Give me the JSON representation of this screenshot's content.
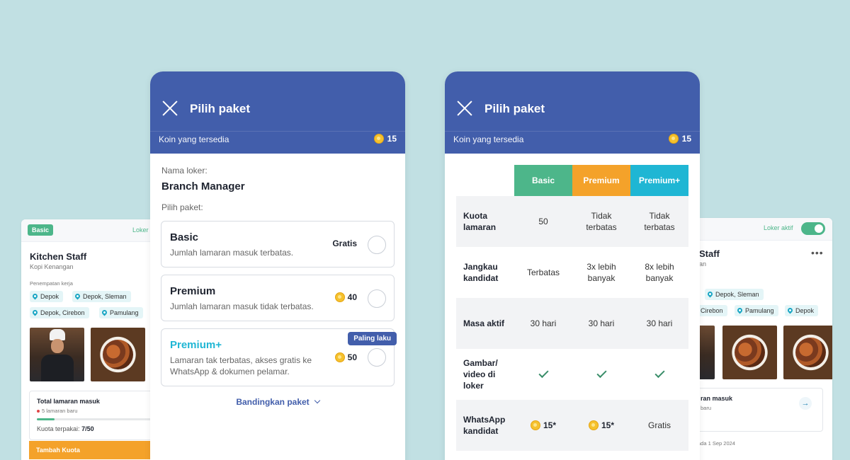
{
  "left_card": {
    "badge": "Basic",
    "status": "Loker",
    "title": "Kitchen Staff",
    "company": "Kopi Kenangan",
    "locations_label": "Penempatan kerja",
    "locations": [
      "Depok",
      "Depok, Sleman",
      "Depok, Cirebon",
      "Pamulang"
    ],
    "stats_title": "Total lamaran masuk",
    "stats_new": "5 lamaran baru",
    "quota_label": "Kuota terpakai:",
    "quota_value": "7/50",
    "quota_progress": 0.14,
    "add_quota_button": "Tambah Kuota"
  },
  "right_card": {
    "status": "Loker aktif",
    "title": "Staff",
    "company_fragment": "an",
    "locations": [
      "Depok, Sleman",
      "Cirebon",
      "Pamulang",
      "Depok"
    ],
    "stats_title": "ran masuk",
    "stats_sub": "baru",
    "date_text": "ada 1 Sep 2024"
  },
  "modal_a": {
    "title": "Pilih paket",
    "coin_label": "Koin yang tersedia",
    "coin_count": "15",
    "job_label": "Nama loker:",
    "job_name": "Branch Manager",
    "package_label": "Pilih paket:",
    "packages": [
      {
        "name": "Basic",
        "desc": "Jumlah lamaran masuk terbatas.",
        "price": "Gratis"
      },
      {
        "name": "Premium",
        "desc": "Jumlah lamaran masuk tidak terbatas.",
        "price": "40"
      },
      {
        "name": "Premium+",
        "desc_line1": "Lamaran tak terbatas, akses gratis ke",
        "desc_line2": "WhatsApp & dokumen pelamar.",
        "price": "50",
        "badge": "Paling laku"
      }
    ],
    "compare_link": "Bandingkan paket"
  },
  "modal_b": {
    "title": "Pilih paket",
    "coin_label": "Koin yang tersedia",
    "coin_count": "15",
    "columns": [
      {
        "name": "Basic",
        "color": "#4db68a"
      },
      {
        "name": "Premium",
        "color": "#f4a22a"
      },
      {
        "name": "Premium+",
        "color": "#1fb6d4"
      }
    ],
    "rows": [
      {
        "label_1": "Kuota",
        "label_2": "lamaran",
        "basic": "50",
        "premium_1": "Tidak",
        "premium_2": "terbatas",
        "plus_1": "Tidak",
        "plus_2": "terbatas"
      },
      {
        "label_1": "Jangkau",
        "label_2": "kandidat",
        "basic": "Terbatas",
        "premium_1": "3x lebih",
        "premium_2": "banyak",
        "plus_1": "8x lebih",
        "plus_2": "banyak"
      },
      {
        "label_1": "Masa aktif",
        "basic": "30 hari",
        "premium": "30 hari",
        "plus": "30 hari"
      },
      {
        "label_1": "Gambar/",
        "label_2": "video di",
        "label_3": "loker"
      },
      {
        "label_1": "WhatsApp",
        "label_2": "kandidat",
        "basic": "15*",
        "premium": "15*",
        "plus": "Gratis"
      }
    ]
  },
  "colors": {
    "background": "#c1e0e3",
    "header": "#425eab",
    "basic": "#4db68a",
    "premium": "#f4a22a",
    "premium_plus": "#1fb6d4"
  }
}
